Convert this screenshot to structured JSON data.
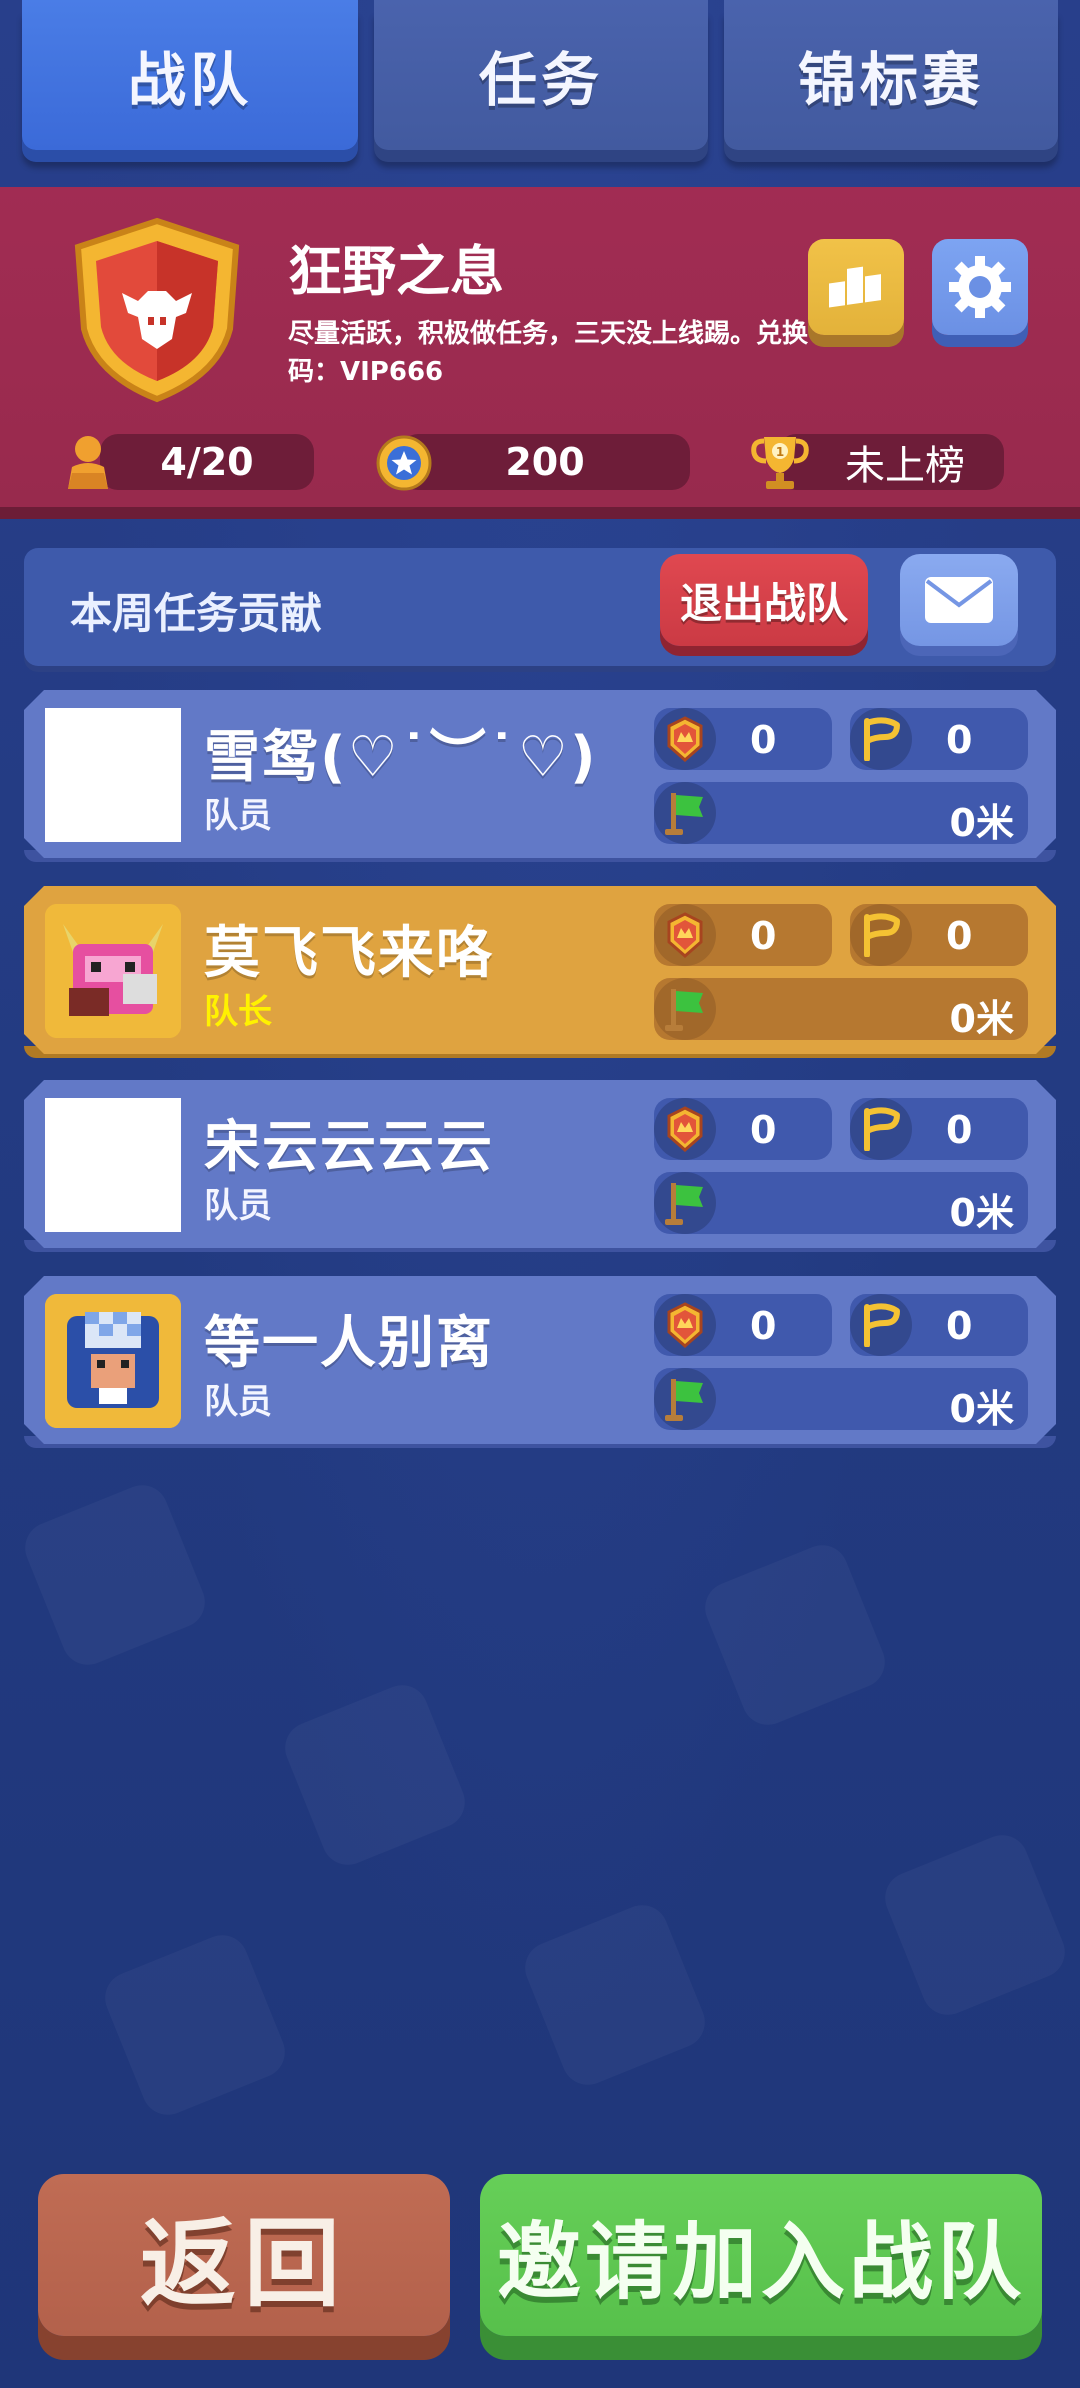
{
  "tabs": [
    {
      "label": "战队",
      "active": true
    },
    {
      "label": "任务",
      "active": false
    },
    {
      "label": "锦标赛",
      "active": false
    }
  ],
  "team": {
    "name": "狂野之息",
    "description": "尽量活跃，积极做任务，三天没上线踢。兑换码：VIP666",
    "members_count": "4/20",
    "points": "200",
    "rank": "未上榜"
  },
  "contribution": {
    "title": "本周任务贡献",
    "exit_label": "退出战队"
  },
  "members": [
    {
      "name": "雪鸳(♡˙︶˙♡)",
      "role": "队员",
      "medals": "0",
      "flags": "0",
      "distance": "0米",
      "avatar": "blank",
      "captain": false
    },
    {
      "name": "莫飞飞来咯",
      "role": "队长",
      "medals": "0",
      "flags": "0",
      "distance": "0米",
      "avatar": "pink-beast",
      "captain": true
    },
    {
      "name": "宋云云云云",
      "role": "队员",
      "medals": "0",
      "flags": "0",
      "distance": "0米",
      "avatar": "blank",
      "captain": false
    },
    {
      "name": "等一人别离",
      "role": "队员",
      "medals": "0",
      "flags": "0",
      "distance": "0米",
      "avatar": "blue-beast",
      "captain": false
    }
  ],
  "buttons": {
    "back": "返回",
    "invite": "邀请加入战队"
  },
  "colors": {
    "tab_active": "#3b6ad8",
    "team_banner": "#a12c53",
    "captain_row": "#dfa340",
    "member_row": "#6279c7",
    "exit_button": "#cb3a44",
    "back_button": "#b3614b",
    "invite_button": "#57c04b"
  },
  "icons": [
    "shield-emblem-icon",
    "podium-icon",
    "gear-icon",
    "person-icon",
    "star-coin-icon",
    "trophy-icon",
    "mail-icon",
    "medal-icon",
    "checkpoint-flag-icon",
    "green-flag-icon"
  ]
}
